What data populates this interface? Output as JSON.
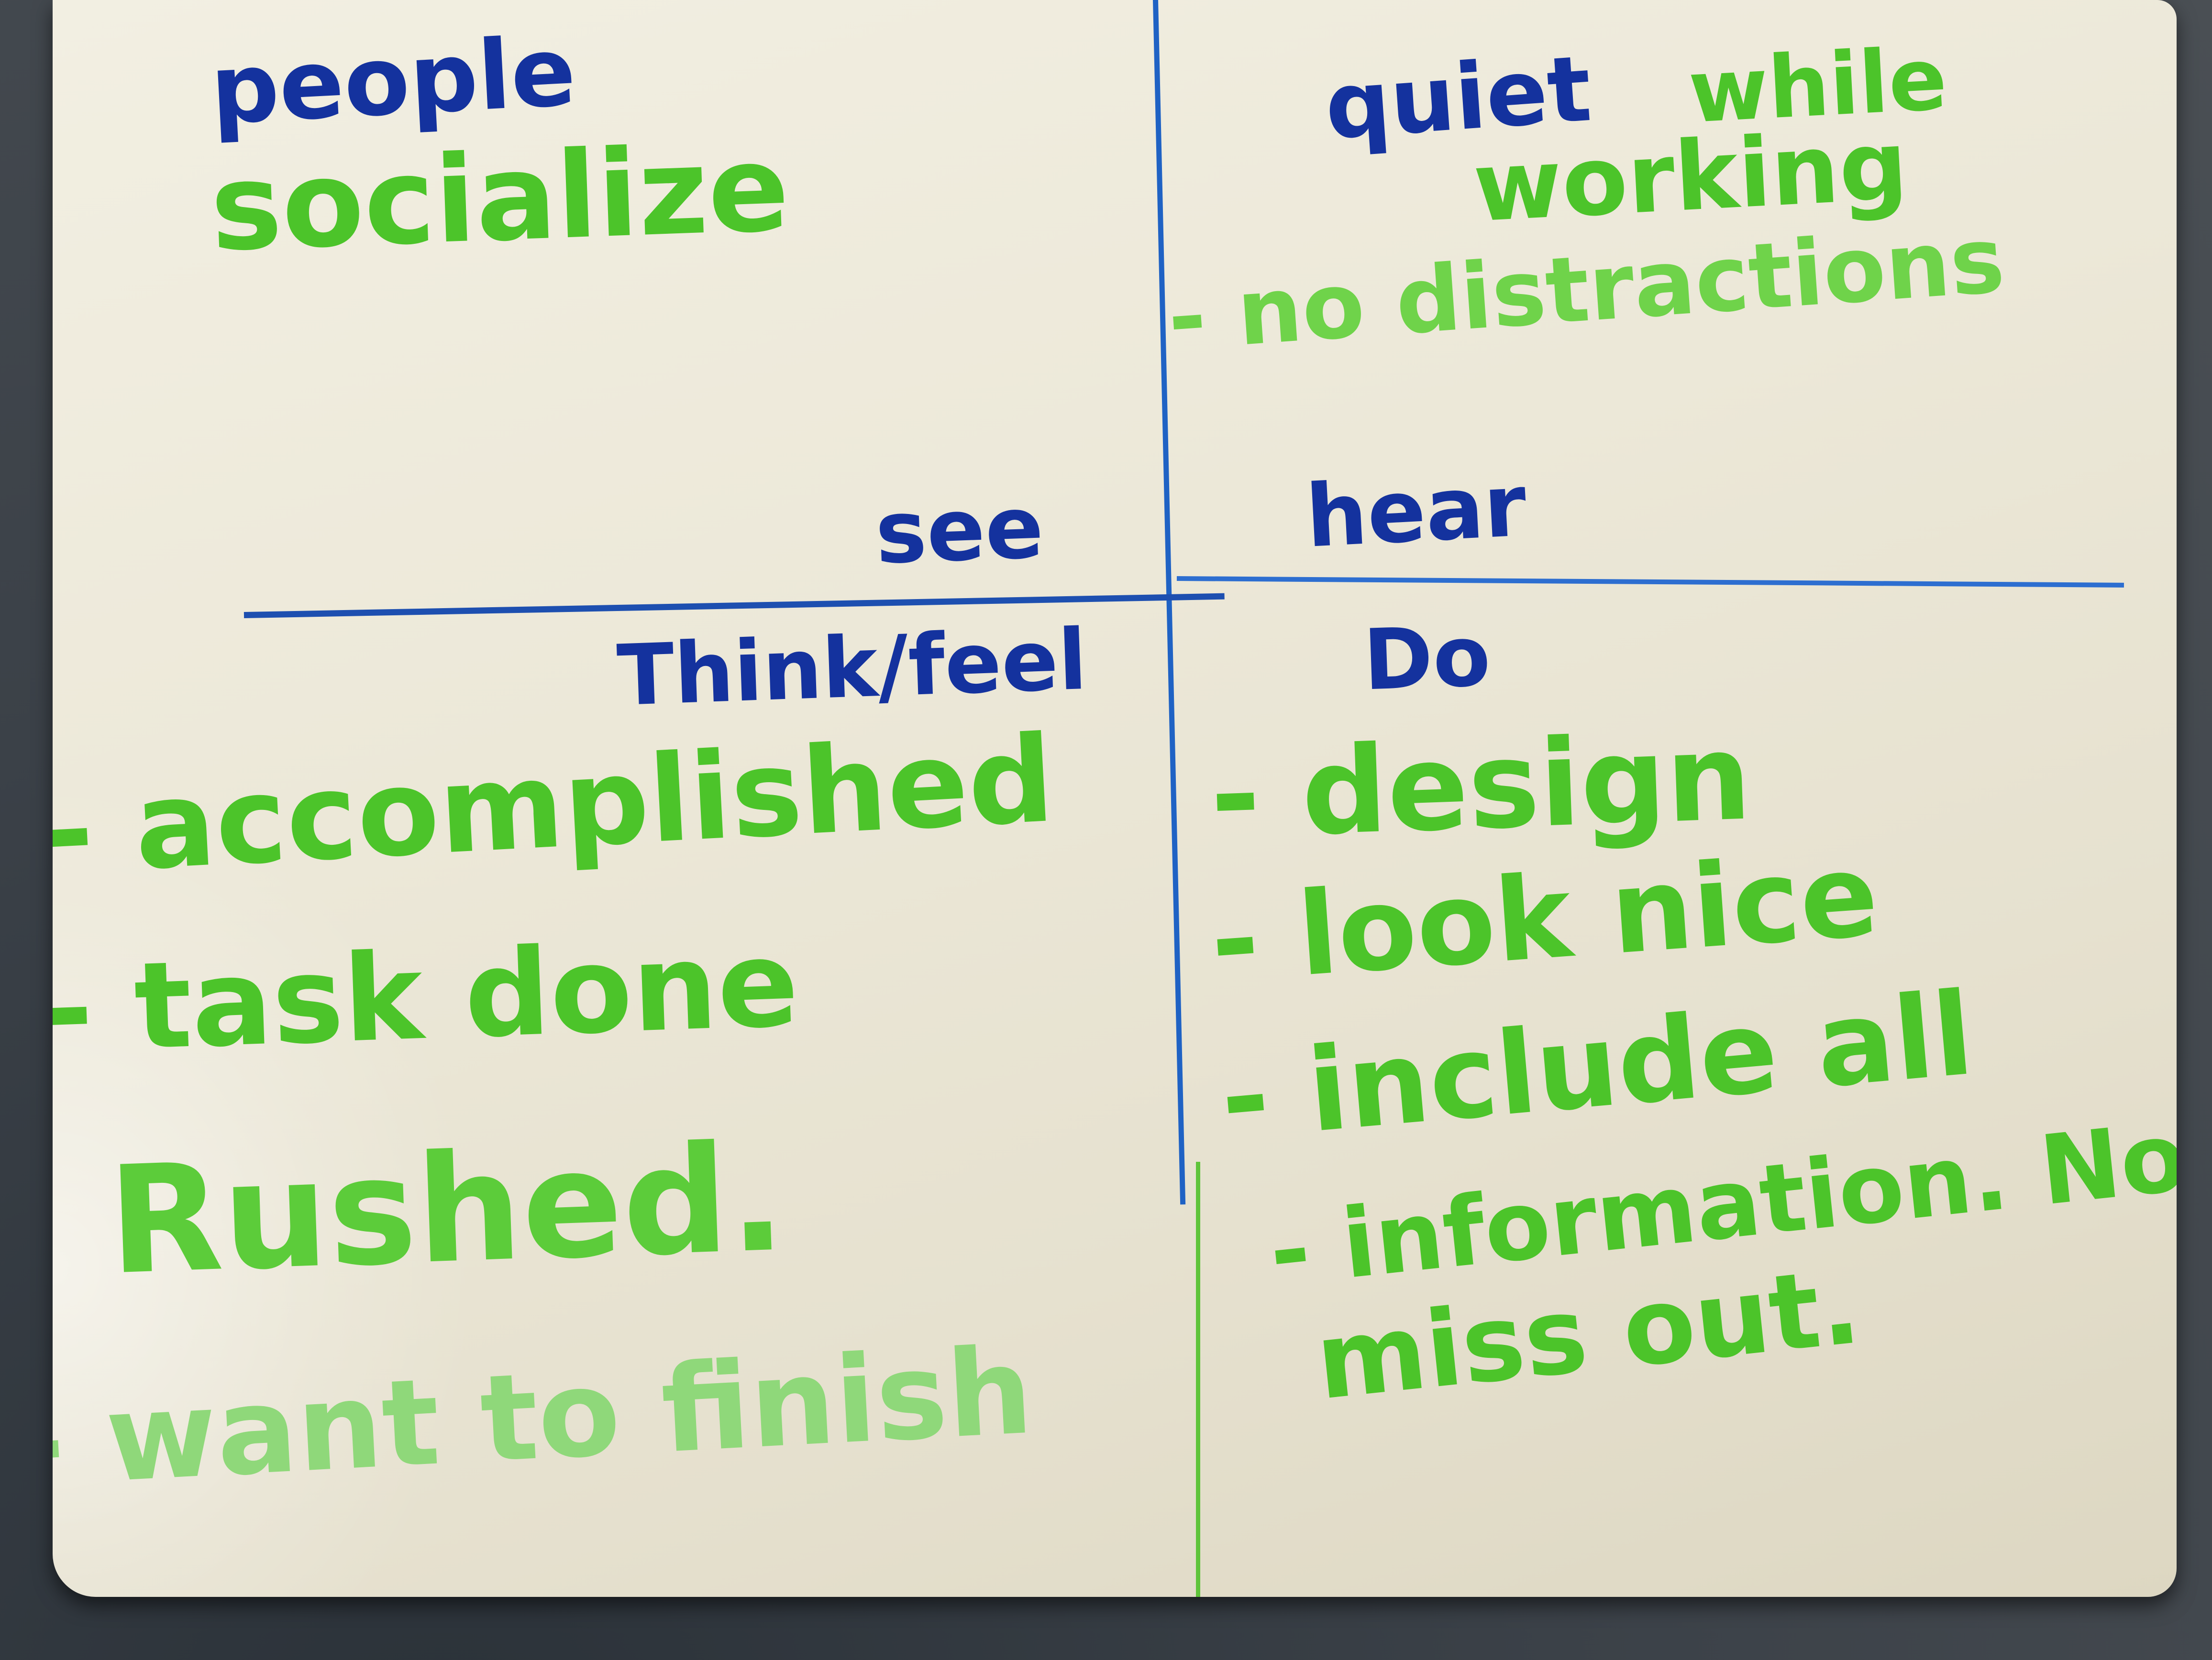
{
  "colors": {
    "blue_marker": "#14329e",
    "green_marker": "#4cc42a",
    "board": "#ece8d8"
  },
  "quadrants": {
    "top_left": {
      "header": "people",
      "lines": [
        "socialize"
      ]
    },
    "top_right": {
      "header": "quiet",
      "lines": [
        "while",
        "working",
        "- no distractions"
      ]
    },
    "labels": {
      "see": "see",
      "hear": "hear",
      "think_feel": "Think/feel",
      "do": "Do"
    },
    "bottom_left": {
      "items": [
        "- accomplished",
        "- task done",
        "- Rushed.",
        "- want to finish"
      ]
    },
    "bottom_right": {
      "items": [
        "- design",
        "- look nice",
        "- include all",
        "- information. No",
        "miss out."
      ]
    }
  }
}
